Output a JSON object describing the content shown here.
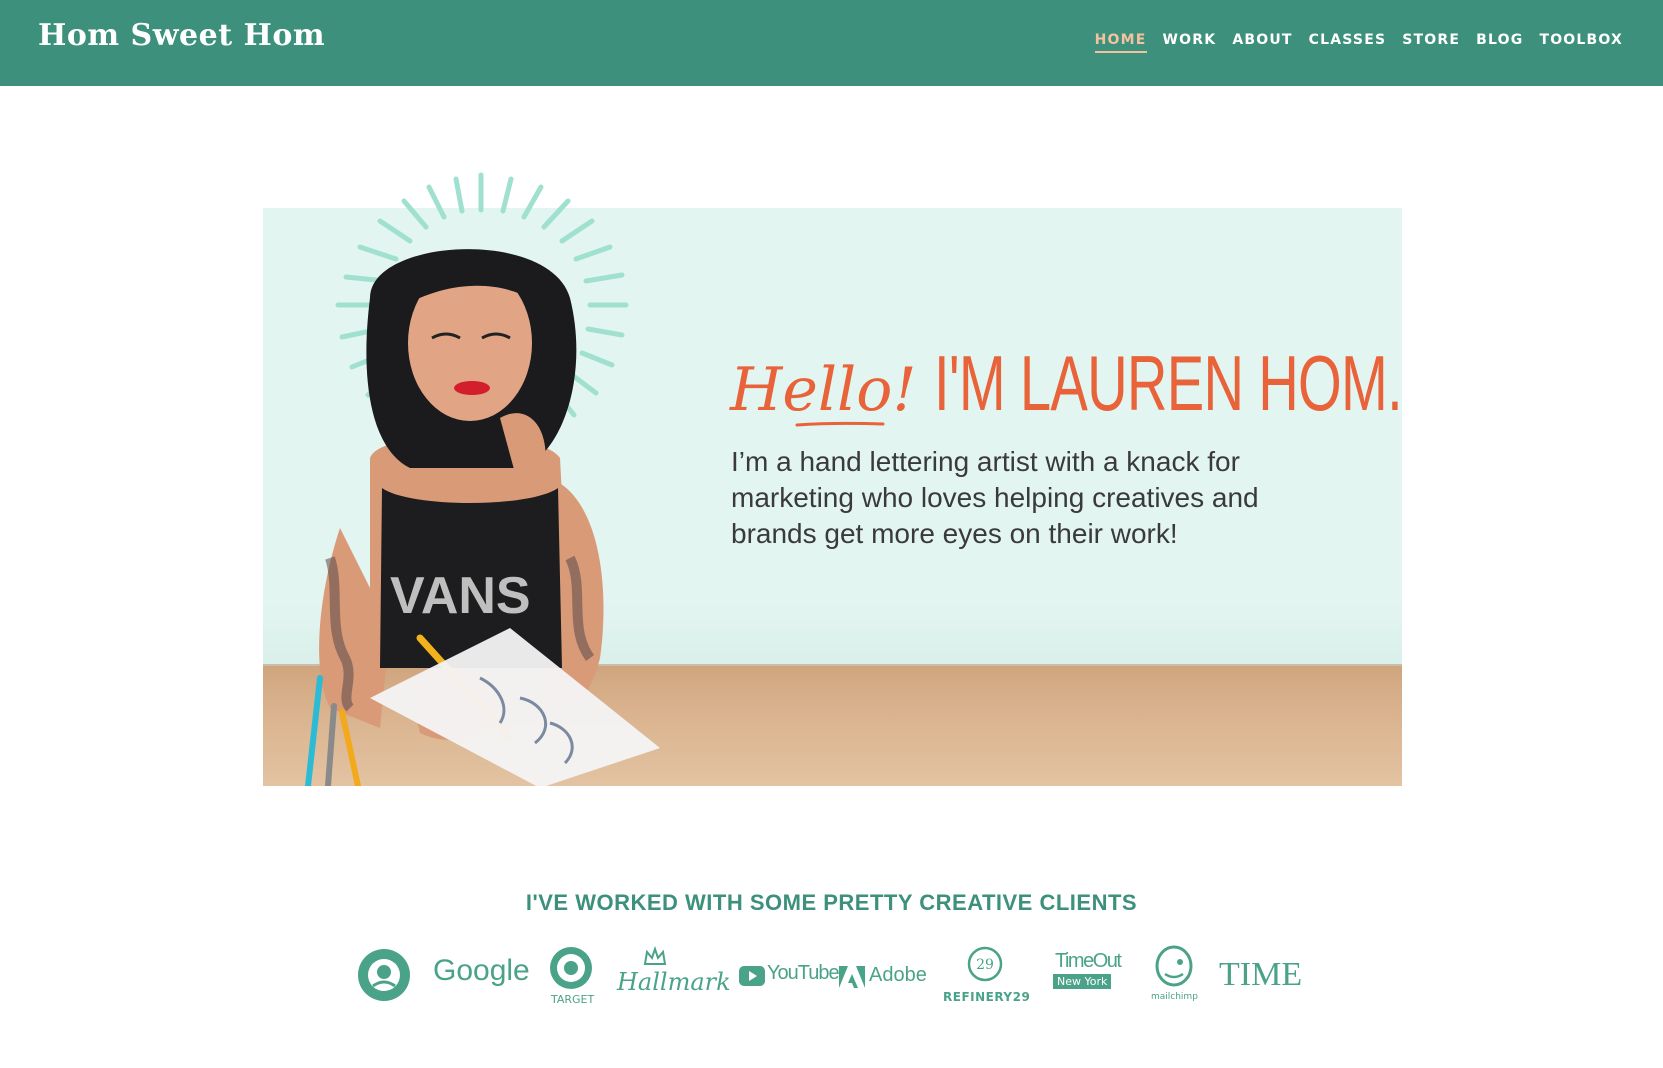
{
  "header": {
    "brand": "Hom Sweet Hom",
    "nav": [
      {
        "label": "HOME",
        "active": true
      },
      {
        "label": "WORK",
        "active": false
      },
      {
        "label": "ABOUT",
        "active": false
      },
      {
        "label": "CLASSES",
        "active": false
      },
      {
        "label": "STORE",
        "active": false
      },
      {
        "label": "BLOG",
        "active": false
      },
      {
        "label": "TOOLBOX",
        "active": false
      }
    ]
  },
  "hero": {
    "greeting": "Hello!",
    "name": "I'M LAUREN HOM.",
    "tagline": "I’m a hand lettering artist with a knack for marketing who loves helping creatives and brands get more eyes on their work!",
    "shirt_text": "VANS"
  },
  "clients": {
    "title": "I'VE WORKED WITH SOME PRETTY CREATIVE CLIENTS",
    "logos": [
      {
        "name": "Starbucks",
        "icon": "starbucks-icon",
        "label": ""
      },
      {
        "name": "Google",
        "icon": "google-icon",
        "label": "Google"
      },
      {
        "name": "Target",
        "icon": "target-icon",
        "label": "TARGET"
      },
      {
        "name": "Hallmark",
        "icon": "hallmark-icon",
        "label": "Hallmark"
      },
      {
        "name": "YouTube",
        "icon": "youtube-icon",
        "label": "YouTube"
      },
      {
        "name": "Adobe",
        "icon": "adobe-icon",
        "label": "Adobe"
      },
      {
        "name": "Refinery29",
        "icon": "refinery29-icon",
        "label": "REFINERY29"
      },
      {
        "name": "TimeOut New York",
        "icon": "timeout-icon",
        "label_top": "TimeOut",
        "label_bottom": "New York"
      },
      {
        "name": "Mailchimp",
        "icon": "mailchimp-icon",
        "label": "mailchimp"
      },
      {
        "name": "TIME",
        "icon": "time-icon",
        "label": "TIME"
      }
    ]
  },
  "colors": {
    "header_bg": "#3d917c",
    "accent_orange": "#e8633a",
    "nav_active": "#f3c29e",
    "hero_bg": "#e3f5f1",
    "client_green": "#4aa389"
  }
}
